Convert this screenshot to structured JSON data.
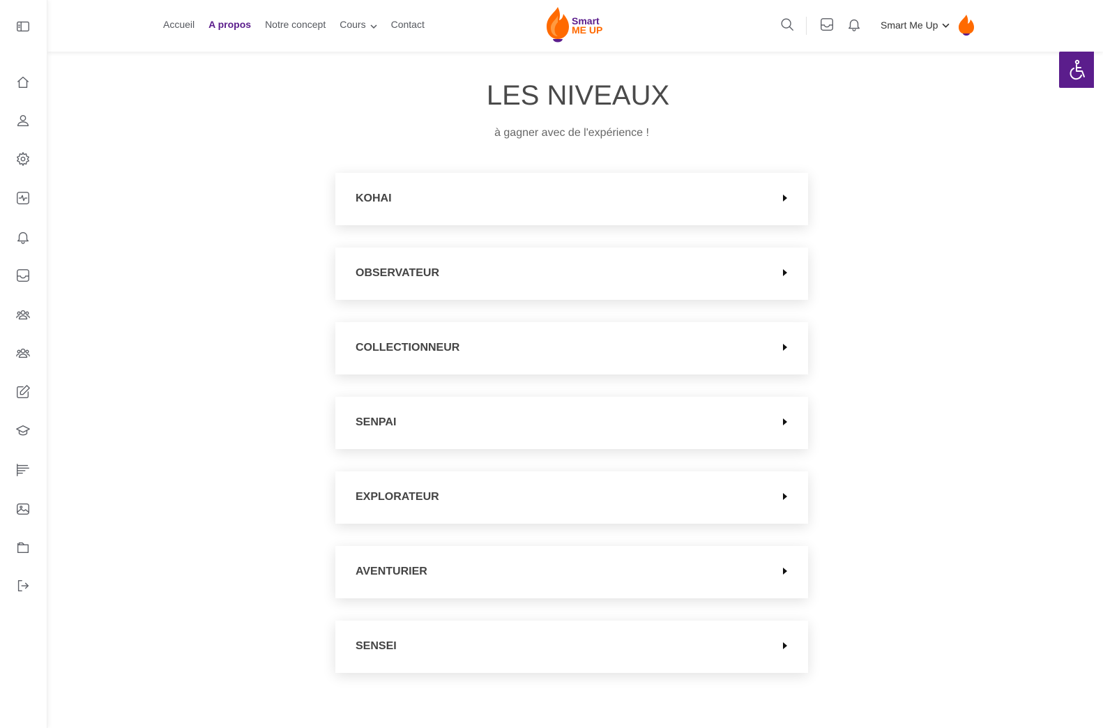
{
  "nav": {
    "items": [
      {
        "label": "Accueil"
      },
      {
        "label": "A propos"
      },
      {
        "label": "Notre concept"
      },
      {
        "label": "Cours"
      },
      {
        "label": "Contact"
      }
    ]
  },
  "brand": {
    "line1": "Smart",
    "line2": "ME UP"
  },
  "user": {
    "name": "Smart Me Up"
  },
  "page": {
    "title": "LES NIVEAUX",
    "subtitle": "à gagner avec de l'expérience !"
  },
  "levels": [
    {
      "name": "KOHAI"
    },
    {
      "name": "OBSERVATEUR"
    },
    {
      "name": "COLLECTIONNEUR"
    },
    {
      "name": "SENPAI"
    },
    {
      "name": "EXPLORATEUR"
    },
    {
      "name": "AVENTURIER"
    },
    {
      "name": "SENSEI"
    }
  ],
  "sidebar": {
    "icons": [
      "sidebar-toggle-icon",
      "home-icon",
      "user-icon",
      "gear-icon",
      "activity-icon",
      "bell-icon",
      "inbox-icon",
      "groups-icon",
      "groups-icon",
      "edit-icon",
      "graduation-icon",
      "forum-icon",
      "photo-icon",
      "folder-icon",
      "logout-icon"
    ]
  },
  "colors": {
    "accent": "#5b1d8c",
    "brand_orange": "#ff6a00"
  }
}
